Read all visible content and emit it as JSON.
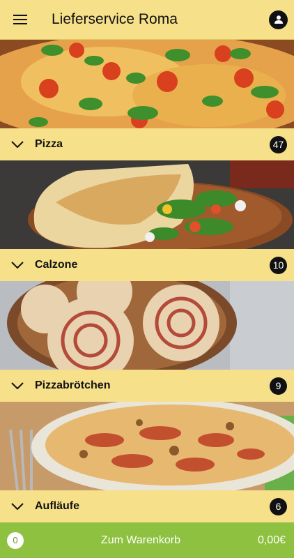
{
  "header": {
    "title": "Lieferservice Roma",
    "menu_icon": "hamburger-menu-icon",
    "account_icon": "user-icon"
  },
  "categories": [
    {
      "label": "Pizza",
      "count": "47",
      "image": "pizza-photo"
    },
    {
      "label": "Calzone",
      "count": "10",
      "image": "calzone-photo"
    },
    {
      "label": "Pizzabrötchen",
      "count": "9",
      "image": "pizza-rolls-photo"
    },
    {
      "label": "Aufläufe",
      "count": "6",
      "image": "casserole-photo"
    }
  ],
  "cart": {
    "count": "0",
    "label": "Zum Warenkorb",
    "total": "0,00€"
  },
  "colors": {
    "bar": "#f6e08a",
    "cart": "#8dc13f",
    "badge": "#111111"
  }
}
